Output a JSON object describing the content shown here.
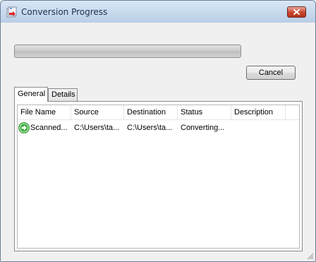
{
  "window": {
    "title": "Conversion Progress",
    "close_icon": "close-icon",
    "app_icon": "conversion-app-icon"
  },
  "progress": {
    "value": 0
  },
  "buttons": {
    "cancel_label": "Cancel"
  },
  "tabs": [
    {
      "label": "General",
      "active": true
    },
    {
      "label": "Details",
      "active": false
    }
  ],
  "table": {
    "columns": [
      "File Name",
      "Source",
      "Destination",
      "Status",
      "Description"
    ],
    "rows": [
      {
        "icon": "play-status-icon",
        "file_name": "Scanned...",
        "source": "C:\\Users\\ta...",
        "destination": "C:\\Users\\ta...",
        "status": "Converting...",
        "description": ""
      }
    ]
  },
  "colors": {
    "title_bar": "#c7d9ee",
    "close_button": "#c7442b",
    "status_icon": "#2e9b2e"
  }
}
